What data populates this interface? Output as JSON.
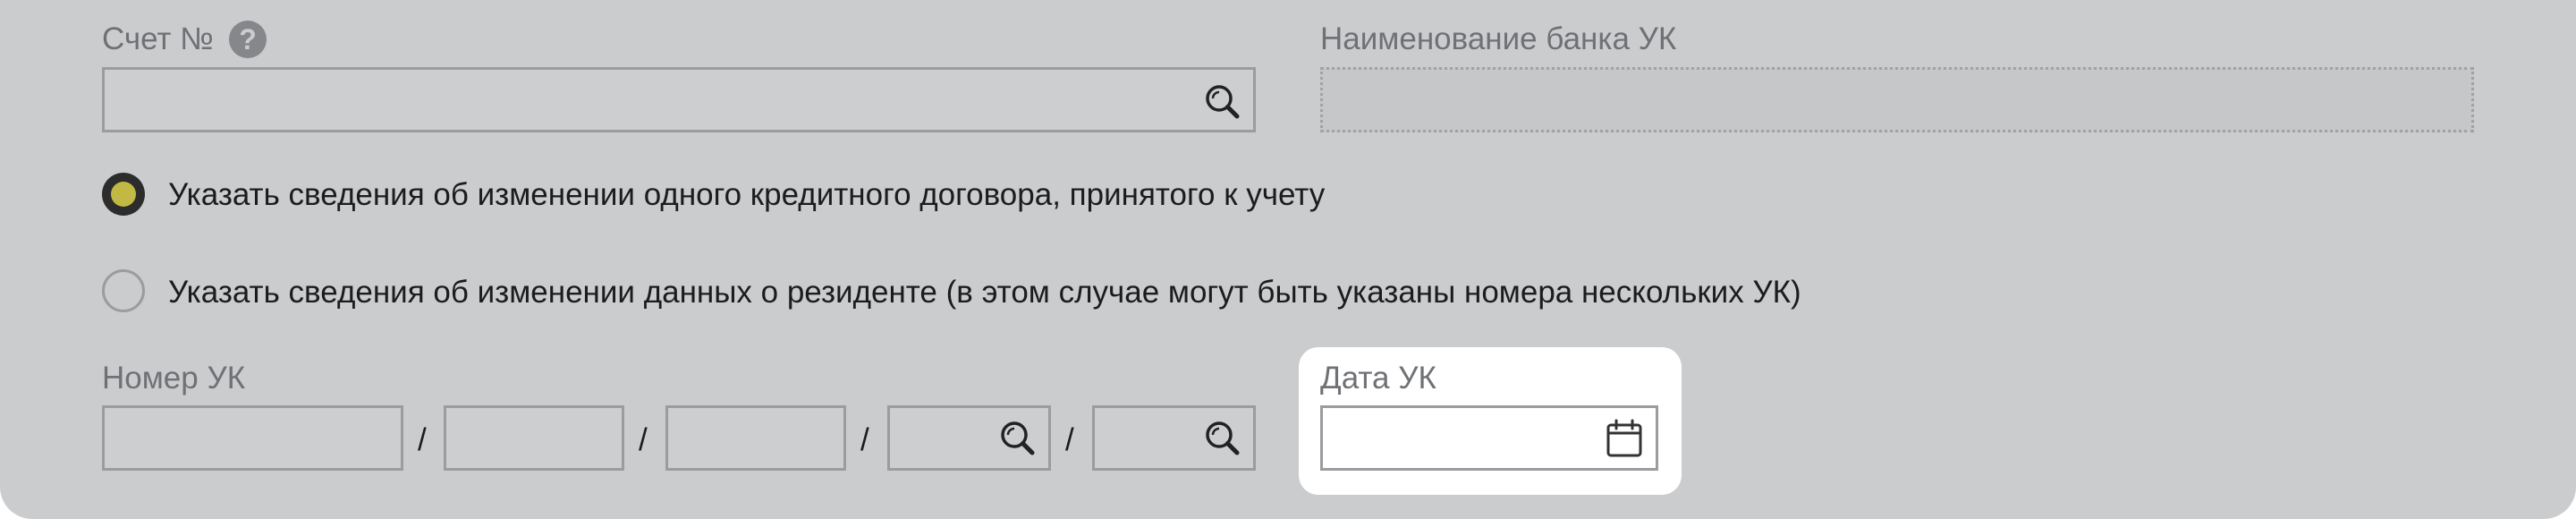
{
  "account": {
    "label": "Счет №",
    "help_icon": "question-circle-icon",
    "help_text": "?",
    "value": "",
    "search_icon": "search-icon"
  },
  "bank": {
    "label": "Наименование банка УК",
    "value": ""
  },
  "options": [
    {
      "label": "Указать сведения об изменении одного кредитного договора, принятого к учету",
      "selected": true
    },
    {
      "label": "Указать сведения об изменении данных о резиденте (в этом случае могут быть указаны номера нескольких УК)",
      "selected": false
    }
  ],
  "uk_number": {
    "label": "Номер УК",
    "separator": "/",
    "parts": [
      "",
      "",
      "",
      "",
      ""
    ]
  },
  "uk_date": {
    "label": "Дата УК",
    "value": "",
    "calendar_icon": "calendar-icon"
  },
  "colors": {
    "panel_bg": "#cbccce",
    "radio_selected_fill": "#c2b844",
    "label_gray": "#6f7175"
  }
}
